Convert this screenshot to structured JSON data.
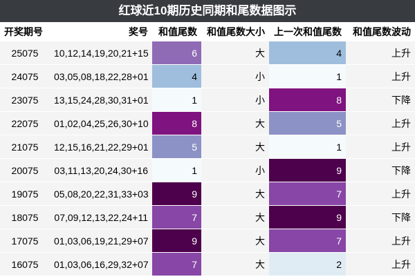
{
  "title": "红球近10期历史同期和尾数据图示",
  "headers": {
    "period": "开奖期号",
    "numbers": "奖号",
    "sum_tail": "和值尾数",
    "size": "和值尾数大小",
    "prev_sum_tail": "上一次和值尾数",
    "trend": "和值尾数波动"
  },
  "rows": [
    {
      "period": "25075",
      "numbers": "10,12,14,19,20,21+15",
      "sum_tail": "6",
      "size": "大",
      "prev_sum_tail": "4",
      "trend": "上升",
      "sum_color": "#8f6bb5",
      "sum_text": "#ffffff",
      "prev_color": "#9fbedd",
      "prev_text": "#000000"
    },
    {
      "period": "24075",
      "numbers": "03,05,08,18,22,28+01",
      "sum_tail": "4",
      "size": "小",
      "prev_sum_tail": "1",
      "trend": "上升",
      "sum_color": "#9fbedd",
      "sum_text": "#000000",
      "prev_color": "#f5fafd",
      "prev_text": "#000000"
    },
    {
      "period": "23075",
      "numbers": "13,15,24,28,30,31+01",
      "sum_tail": "1",
      "size": "小",
      "prev_sum_tail": "8",
      "trend": "下降",
      "sum_color": "#f5fafd",
      "sum_text": "#000000",
      "prev_color": "#7f137f",
      "prev_text": "#ffffff"
    },
    {
      "period": "22075",
      "numbers": "01,02,04,25,26,30+10",
      "sum_tail": "8",
      "size": "大",
      "prev_sum_tail": "5",
      "trend": "上升",
      "sum_color": "#7f137f",
      "sum_text": "#ffffff",
      "prev_color": "#8c92c5",
      "prev_text": "#ffffff"
    },
    {
      "period": "21075",
      "numbers": "12,15,16,21,22,29+01",
      "sum_tail": "5",
      "size": "大",
      "prev_sum_tail": "1",
      "trend": "上升",
      "sum_color": "#8c92c5",
      "sum_text": "#ffffff",
      "prev_color": "#f5fafd",
      "prev_text": "#000000"
    },
    {
      "period": "20075",
      "numbers": "03,11,13,20,24,30+16",
      "sum_tail": "1",
      "size": "小",
      "prev_sum_tail": "9",
      "trend": "下降",
      "sum_color": "#f5fafd",
      "sum_text": "#000000",
      "prev_color": "#4d004b",
      "prev_text": "#ffffff"
    },
    {
      "period": "19075",
      "numbers": "05,08,20,22,31,33+03",
      "sum_tail": "9",
      "size": "大",
      "prev_sum_tail": "7",
      "trend": "上升",
      "sum_color": "#4d004b",
      "sum_text": "#ffffff",
      "prev_color": "#8846a6",
      "prev_text": "#ffffff"
    },
    {
      "period": "18075",
      "numbers": "07,09,12,13,22,24+11",
      "sum_tail": "7",
      "size": "大",
      "prev_sum_tail": "9",
      "trend": "下降",
      "sum_color": "#8846a6",
      "sum_text": "#ffffff",
      "prev_color": "#4d004b",
      "prev_text": "#ffffff"
    },
    {
      "period": "17075",
      "numbers": "01,03,06,19,21,29+07",
      "sum_tail": "9",
      "size": "大",
      "prev_sum_tail": "7",
      "trend": "上升",
      "sum_color": "#4d004b",
      "sum_text": "#ffffff",
      "prev_color": "#8846a6",
      "prev_text": "#ffffff"
    },
    {
      "period": "16075",
      "numbers": "01,03,06,16,29,32+07",
      "sum_tail": "7",
      "size": "大",
      "prev_sum_tail": "2",
      "trend": "上升",
      "sum_color": "#8846a6",
      "sum_text": "#ffffff",
      "prev_color": "#e0ecf4",
      "prev_text": "#000000"
    }
  ]
}
